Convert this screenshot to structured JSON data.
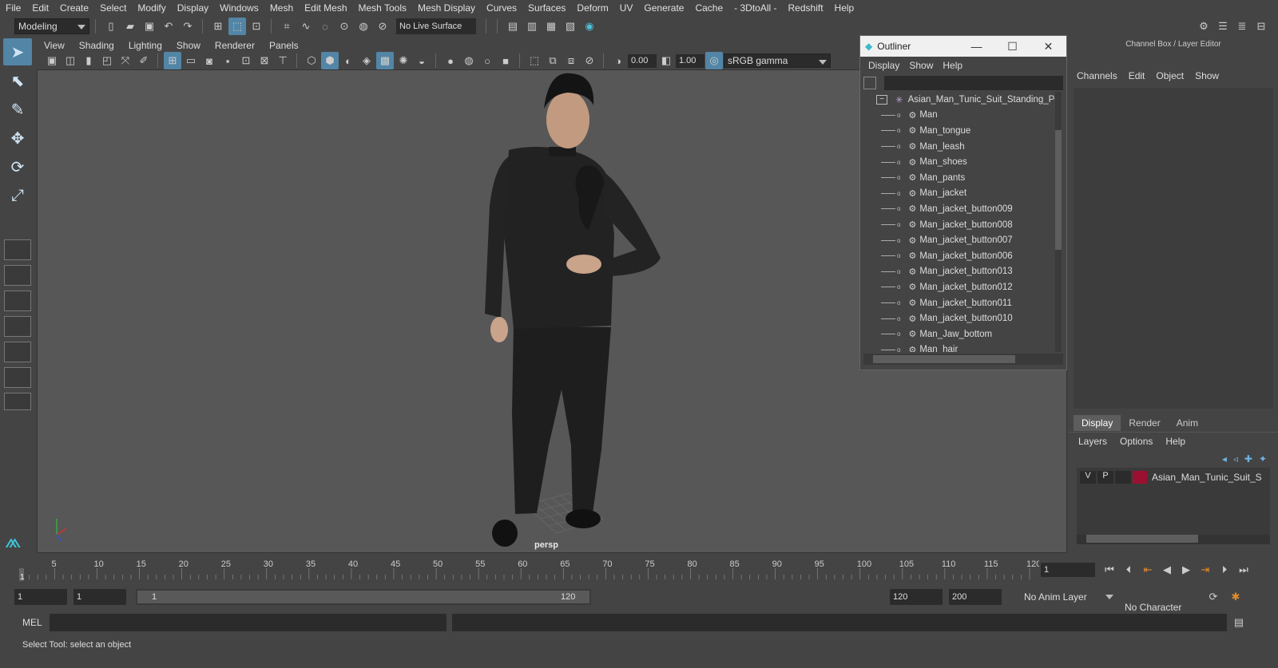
{
  "menu": [
    "File",
    "Edit",
    "Create",
    "Select",
    "Modify",
    "Display",
    "Windows",
    "Mesh",
    "Edit Mesh",
    "Mesh Tools",
    "Mesh Display",
    "Curves",
    "Surfaces",
    "Deform",
    "UV",
    "Generate",
    "Cache",
    "- 3DtoAll -",
    "Redshift",
    "Help"
  ],
  "status": {
    "mode": "Modeling",
    "live_surface": "No Live Surface"
  },
  "viewport": {
    "menu": [
      "View",
      "Shading",
      "Lighting",
      "Show",
      "Renderer",
      "Panels"
    ],
    "exposure": "0.00",
    "gamma": "1.00",
    "color_space": "sRGB gamma",
    "camera": "persp"
  },
  "outliner": {
    "title": "Outliner",
    "menu": [
      "Display",
      "Show",
      "Help"
    ],
    "root": "Asian_Man_Tunic_Suit_Standing_Po",
    "items": [
      "Man",
      "Man_tongue",
      "Man_leash",
      "Man_shoes",
      "Man_pants",
      "Man_jacket",
      "Man_jacket_button009",
      "Man_jacket_button008",
      "Man_jacket_button007",
      "Man_jacket_button006",
      "Man_jacket_button013",
      "Man_jacket_button012",
      "Man_jacket_button011",
      "Man_jacket_button010",
      "Man_Jaw_bottom",
      "Man_hair"
    ]
  },
  "channelbox": {
    "title": "Channel Box / Layer Editor",
    "menu": [
      "Channels",
      "Edit",
      "Object",
      "Show"
    ],
    "tabs": [
      "Display",
      "Render",
      "Anim"
    ],
    "layer_menu": [
      "Layers",
      "Options",
      "Help"
    ],
    "layer": {
      "v": "V",
      "p": "P",
      "name": "Asian_Man_Tunic_Suit_S",
      "color": "#9b1030"
    }
  },
  "timeline": {
    "ticks": [
      "5",
      "10",
      "15",
      "20",
      "25",
      "30",
      "35",
      "40",
      "45",
      "50",
      "55",
      "60",
      "65",
      "70",
      "75",
      "80",
      "85",
      "90",
      "95",
      "100",
      "105",
      "110",
      "115",
      "120"
    ],
    "current_frame": "1",
    "current_field": "1"
  },
  "range": {
    "start": "1",
    "start2": "1",
    "slider_start": "1",
    "slider_end": "120",
    "end": "120",
    "end2": "200",
    "anim_layer": "No Anim Layer",
    "char_set": "No Character Set"
  },
  "cmd": {
    "label": "MEL"
  },
  "help": "Select Tool: select an object",
  "colors": {
    "accent": "#5285a6",
    "bg": "#444444",
    "viewport": "#575757"
  }
}
